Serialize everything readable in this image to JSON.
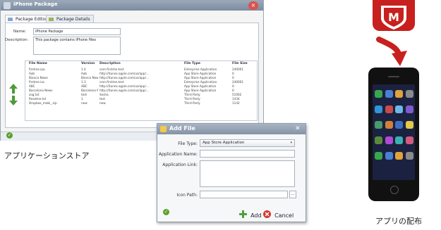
{
  "package_window": {
    "title": "iPhone Package",
    "tabs": [
      {
        "label": "Package Editor",
        "active": true
      },
      {
        "label": "Package Details",
        "active": false
      }
    ],
    "name_label": "Name:",
    "name_value": "iPhone Package",
    "description_label": "Description:",
    "description_value": "This package contains iPhone files",
    "file_table": {
      "columns": [
        "File Name",
        "Version",
        "Description",
        "File Type",
        "File Size"
      ],
      "rows": [
        [
          "firstme.ipa",
          "1.4",
          "com.firstme.test",
          "Enterprise Application",
          "240001"
        ],
        [
          "Aab",
          "Aab",
          "http://itunes.apple.com/us/app/...",
          "App Store Application",
          "0"
        ],
        [
          "Bianca News",
          "Bianca News",
          "http://itunes.apple.com/us/app/...",
          "App Store Application",
          "0"
        ],
        [
          "firstme.ios",
          "1.3",
          "com.firstme.test",
          "Enterprise Application",
          "240001"
        ],
        [
          "ABC",
          "ABC",
          "http://itunes.apple.com/us/app/...",
          "App Store Application",
          "0"
        ],
        [
          "Barcelona News",
          "Barcelona News",
          "http://itunes.apple.com/us/app/...",
          "App Store Application",
          "0"
        ],
        [
          "zog.txt",
          "test",
          "Sesha",
          "Third Party",
          "51002"
        ],
        [
          "Readme.txt",
          "1",
          "test",
          "Third Party",
          "1434"
        ],
        [
          "Dropbox_mobi_.zip",
          "new",
          "new",
          "Third Party",
          "1142"
        ]
      ]
    }
  },
  "captions": {
    "app_store": "アプリケーションストア",
    "distribution": "アプリの配布"
  },
  "add_file_dialog": {
    "title": "Add File",
    "file_type_label": "File Type:",
    "file_type_value": "App Store Application",
    "app_name_label": "Application Name:",
    "app_name_value": "",
    "app_link_label": "Application Link:",
    "app_link_value": "",
    "icon_path_label": "Icon Path:",
    "icon_path_value": "",
    "browse_label": "...",
    "add_label": "Add",
    "cancel_label": "Cancel"
  },
  "logo": {
    "letter": "M"
  },
  "colors": {
    "accent_red": "#c8201e",
    "titlebar": "#8a99ad",
    "ok_green": "#5aa02c",
    "add_green": "#4aa33a",
    "cancel_red": "#d9342b"
  },
  "icons": [
    "package-icon",
    "tab-icon",
    "up-arrow-icon",
    "down-arrow-icon",
    "ok-icon",
    "close-icon",
    "add-icon",
    "cancel-icon",
    "dropdown-icon",
    "browse-icon",
    "mcafee-logo-icon",
    "distribute-arrow-icon",
    "iphone-icon"
  ]
}
